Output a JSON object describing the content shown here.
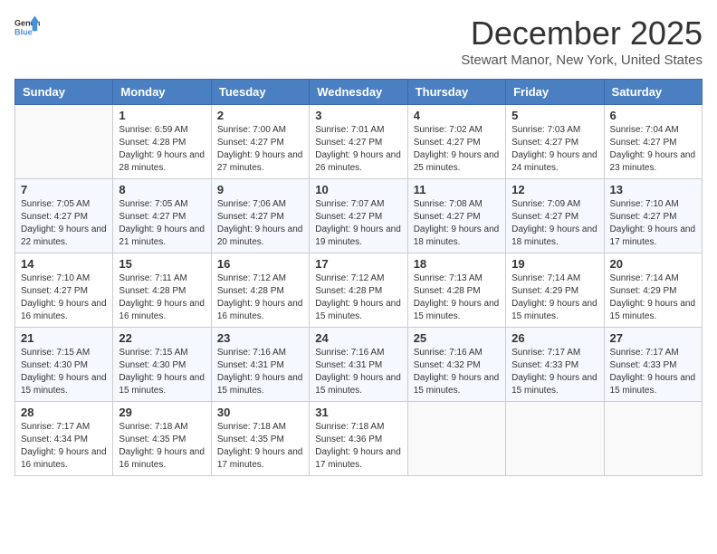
{
  "logo": {
    "general": "General",
    "blue": "Blue"
  },
  "title": "December 2025",
  "subtitle": "Stewart Manor, New York, United States",
  "headers": [
    "Sunday",
    "Monday",
    "Tuesday",
    "Wednesday",
    "Thursday",
    "Friday",
    "Saturday"
  ],
  "weeks": [
    [
      {
        "day": "",
        "sunrise": "",
        "sunset": "",
        "daylight": ""
      },
      {
        "day": "1",
        "sunrise": "Sunrise: 6:59 AM",
        "sunset": "Sunset: 4:28 PM",
        "daylight": "Daylight: 9 hours and 28 minutes."
      },
      {
        "day": "2",
        "sunrise": "Sunrise: 7:00 AM",
        "sunset": "Sunset: 4:27 PM",
        "daylight": "Daylight: 9 hours and 27 minutes."
      },
      {
        "day": "3",
        "sunrise": "Sunrise: 7:01 AM",
        "sunset": "Sunset: 4:27 PM",
        "daylight": "Daylight: 9 hours and 26 minutes."
      },
      {
        "day": "4",
        "sunrise": "Sunrise: 7:02 AM",
        "sunset": "Sunset: 4:27 PM",
        "daylight": "Daylight: 9 hours and 25 minutes."
      },
      {
        "day": "5",
        "sunrise": "Sunrise: 7:03 AM",
        "sunset": "Sunset: 4:27 PM",
        "daylight": "Daylight: 9 hours and 24 minutes."
      },
      {
        "day": "6",
        "sunrise": "Sunrise: 7:04 AM",
        "sunset": "Sunset: 4:27 PM",
        "daylight": "Daylight: 9 hours and 23 minutes."
      }
    ],
    [
      {
        "day": "7",
        "sunrise": "Sunrise: 7:05 AM",
        "sunset": "Sunset: 4:27 PM",
        "daylight": "Daylight: 9 hours and 22 minutes."
      },
      {
        "day": "8",
        "sunrise": "Sunrise: 7:05 AM",
        "sunset": "Sunset: 4:27 PM",
        "daylight": "Daylight: 9 hours and 21 minutes."
      },
      {
        "day": "9",
        "sunrise": "Sunrise: 7:06 AM",
        "sunset": "Sunset: 4:27 PM",
        "daylight": "Daylight: 9 hours and 20 minutes."
      },
      {
        "day": "10",
        "sunrise": "Sunrise: 7:07 AM",
        "sunset": "Sunset: 4:27 PM",
        "daylight": "Daylight: 9 hours and 19 minutes."
      },
      {
        "day": "11",
        "sunrise": "Sunrise: 7:08 AM",
        "sunset": "Sunset: 4:27 PM",
        "daylight": "Daylight: 9 hours and 18 minutes."
      },
      {
        "day": "12",
        "sunrise": "Sunrise: 7:09 AM",
        "sunset": "Sunset: 4:27 PM",
        "daylight": "Daylight: 9 hours and 18 minutes."
      },
      {
        "day": "13",
        "sunrise": "Sunrise: 7:10 AM",
        "sunset": "Sunset: 4:27 PM",
        "daylight": "Daylight: 9 hours and 17 minutes."
      }
    ],
    [
      {
        "day": "14",
        "sunrise": "Sunrise: 7:10 AM",
        "sunset": "Sunset: 4:27 PM",
        "daylight": "Daylight: 9 hours and 16 minutes."
      },
      {
        "day": "15",
        "sunrise": "Sunrise: 7:11 AM",
        "sunset": "Sunset: 4:28 PM",
        "daylight": "Daylight: 9 hours and 16 minutes."
      },
      {
        "day": "16",
        "sunrise": "Sunrise: 7:12 AM",
        "sunset": "Sunset: 4:28 PM",
        "daylight": "Daylight: 9 hours and 16 minutes."
      },
      {
        "day": "17",
        "sunrise": "Sunrise: 7:12 AM",
        "sunset": "Sunset: 4:28 PM",
        "daylight": "Daylight: 9 hours and 15 minutes."
      },
      {
        "day": "18",
        "sunrise": "Sunrise: 7:13 AM",
        "sunset": "Sunset: 4:28 PM",
        "daylight": "Daylight: 9 hours and 15 minutes."
      },
      {
        "day": "19",
        "sunrise": "Sunrise: 7:14 AM",
        "sunset": "Sunset: 4:29 PM",
        "daylight": "Daylight: 9 hours and 15 minutes."
      },
      {
        "day": "20",
        "sunrise": "Sunrise: 7:14 AM",
        "sunset": "Sunset: 4:29 PM",
        "daylight": "Daylight: 9 hours and 15 minutes."
      }
    ],
    [
      {
        "day": "21",
        "sunrise": "Sunrise: 7:15 AM",
        "sunset": "Sunset: 4:30 PM",
        "daylight": "Daylight: 9 hours and 15 minutes."
      },
      {
        "day": "22",
        "sunrise": "Sunrise: 7:15 AM",
        "sunset": "Sunset: 4:30 PM",
        "daylight": "Daylight: 9 hours and 15 minutes."
      },
      {
        "day": "23",
        "sunrise": "Sunrise: 7:16 AM",
        "sunset": "Sunset: 4:31 PM",
        "daylight": "Daylight: 9 hours and 15 minutes."
      },
      {
        "day": "24",
        "sunrise": "Sunrise: 7:16 AM",
        "sunset": "Sunset: 4:31 PM",
        "daylight": "Daylight: 9 hours and 15 minutes."
      },
      {
        "day": "25",
        "sunrise": "Sunrise: 7:16 AM",
        "sunset": "Sunset: 4:32 PM",
        "daylight": "Daylight: 9 hours and 15 minutes."
      },
      {
        "day": "26",
        "sunrise": "Sunrise: 7:17 AM",
        "sunset": "Sunset: 4:33 PM",
        "daylight": "Daylight: 9 hours and 15 minutes."
      },
      {
        "day": "27",
        "sunrise": "Sunrise: 7:17 AM",
        "sunset": "Sunset: 4:33 PM",
        "daylight": "Daylight: 9 hours and 15 minutes."
      }
    ],
    [
      {
        "day": "28",
        "sunrise": "Sunrise: 7:17 AM",
        "sunset": "Sunset: 4:34 PM",
        "daylight": "Daylight: 9 hours and 16 minutes."
      },
      {
        "day": "29",
        "sunrise": "Sunrise: 7:18 AM",
        "sunset": "Sunset: 4:35 PM",
        "daylight": "Daylight: 9 hours and 16 minutes."
      },
      {
        "day": "30",
        "sunrise": "Sunrise: 7:18 AM",
        "sunset": "Sunset: 4:35 PM",
        "daylight": "Daylight: 9 hours and 17 minutes."
      },
      {
        "day": "31",
        "sunrise": "Sunrise: 7:18 AM",
        "sunset": "Sunset: 4:36 PM",
        "daylight": "Daylight: 9 hours and 17 minutes."
      },
      {
        "day": "",
        "sunrise": "",
        "sunset": "",
        "daylight": ""
      },
      {
        "day": "",
        "sunrise": "",
        "sunset": "",
        "daylight": ""
      },
      {
        "day": "",
        "sunrise": "",
        "sunset": "",
        "daylight": ""
      }
    ]
  ]
}
